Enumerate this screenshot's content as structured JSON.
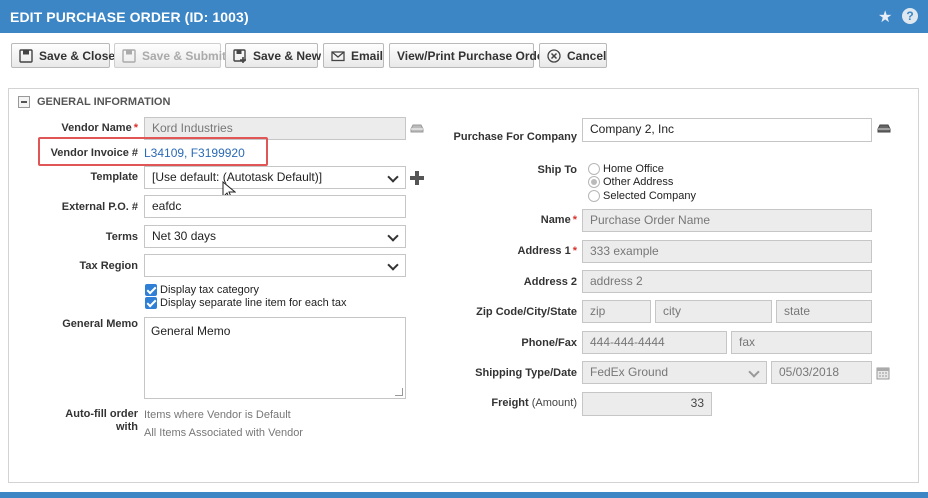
{
  "window": {
    "title": "EDIT PURCHASE ORDER (ID: 1003)"
  },
  "toolbar": {
    "save_close": "Save & Close",
    "save_submit": "Save & Submit",
    "save_new": "Save & New",
    "email": "Email",
    "view_print": "View/Print Purchase Order",
    "cancel": "Cancel"
  },
  "section": {
    "title": "GENERAL INFORMATION"
  },
  "left": {
    "vendor_name_label": "Vendor Name",
    "vendor_name_value": "Kord Industries",
    "vendor_invoice_label": "Vendor Invoice #",
    "vendor_invoice_links": "L34109, F3199920",
    "template_label": "Template",
    "template_value": "[Use default: (Autotask Default)]",
    "external_po_label": "External P.O. #",
    "external_po_value": "eafdc",
    "terms_label": "Terms",
    "terms_value": "Net 30 days",
    "tax_region_label": "Tax Region",
    "tax_region_value": "",
    "display_tax_category": "Display tax category",
    "display_separate_line": "Display separate line item for each tax",
    "general_memo_label": "General Memo",
    "general_memo_value": "General Memo",
    "autofill_label_1": "Auto-fill order",
    "autofill_label_2": "with",
    "autofill_option_1": "Items where Vendor is Default",
    "autofill_option_2": "All Items Associated with Vendor"
  },
  "right": {
    "purchase_for_label": "Purchase For Company",
    "purchase_for_value": "Company 2, Inc",
    "ship_to_label": "Ship To",
    "ship_to_options": [
      "Home Office",
      "Other Address",
      "Selected Company"
    ],
    "ship_to_selected": "Other Address",
    "name_label": "Name",
    "name_value": "Purchase Order Name",
    "address1_label": "Address 1",
    "address1_value": "333 example",
    "address2_label": "Address 2",
    "address2_value": "address 2",
    "zip_label": "Zip Code/City/State",
    "zip_value": "zip",
    "city_value": "city",
    "state_value": "state",
    "phone_label": "Phone/Fax",
    "phone_value": "444-444-4444",
    "fax_value": "fax",
    "shipping_label": "Shipping Type/Date",
    "shipping_type_value": "FedEx Ground",
    "shipping_date_value": "05/03/2018",
    "freight_label": "Freight",
    "freight_sub": "(Amount)",
    "freight_value": "33"
  },
  "colors": {
    "titlebar": "#3c86c6",
    "link": "#2b6ab5",
    "required": "#d9312b",
    "highlight": "#e05555"
  }
}
